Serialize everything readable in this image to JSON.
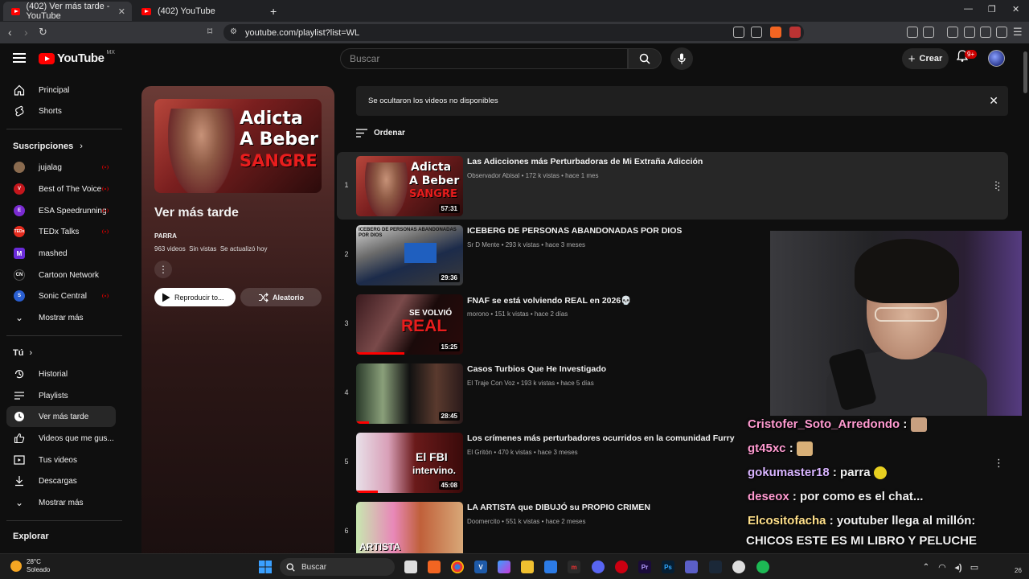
{
  "browser": {
    "tabs": [
      {
        "title": "(402) Ver más tarde - YouTube",
        "active": true
      },
      {
        "title": "(402) YouTube",
        "active": false
      }
    ],
    "new_tab": "+",
    "url": "youtube.com/playlist?list=WL"
  },
  "masthead": {
    "logo": "YouTube",
    "country": "MX",
    "search_placeholder": "Buscar",
    "create_label": "Crear",
    "notif_badge": "9+"
  },
  "sidebar": {
    "main": [
      {
        "label": "Principal",
        "icon": "home-icon"
      },
      {
        "label": "Shorts",
        "icon": "shorts-icon"
      }
    ],
    "subs_title": "Suscripciones",
    "subs": [
      {
        "label": "jujalag",
        "color": "#8a6b4f",
        "abbr": ""
      },
      {
        "label": "Best of The Voice",
        "color": "#c4161c",
        "abbr": "V"
      },
      {
        "label": "ESA Speedrunning",
        "color": "#7a2bd1",
        "abbr": "E"
      },
      {
        "label": "TEDx Talks",
        "color": "#e62b1e",
        "abbr": "TEDx"
      },
      {
        "label": "mashed",
        "color": "#6a2bd9",
        "abbr": "M"
      },
      {
        "label": "Cartoon Network",
        "color": "#111111",
        "abbr": "CN"
      },
      {
        "label": "Sonic Central",
        "color": "#2a5fd1",
        "abbr": "S"
      }
    ],
    "subs_more": "Mostrar más",
    "you_title": "Tú",
    "you": [
      {
        "label": "Historial",
        "icon": "history-icon"
      },
      {
        "label": "Playlists",
        "icon": "playlists-icon"
      },
      {
        "label": "Ver más tarde",
        "icon": "watch-later-icon"
      },
      {
        "label": "Videos que me gus...",
        "icon": "thumbs-up-icon"
      },
      {
        "label": "Tus videos",
        "icon": "your-videos-icon"
      },
      {
        "label": "Descargas",
        "icon": "download-icon"
      }
    ],
    "you_more": "Mostrar más",
    "explore_title": "Explorar"
  },
  "playlist": {
    "thumb_line1": "Adicta",
    "thumb_line2": "A Beber",
    "thumb_line3": "SANGRE",
    "title": "Ver más tarde",
    "owner": "PARRA",
    "videos": "963 videos",
    "views": "Sin vistas",
    "updated": "Se actualizó hoy",
    "play_all": "Reproducir to...",
    "shuffle": "Aleatorio"
  },
  "notice": "Se ocultaron los videos no disponibles",
  "sort_label": "Ordenar",
  "videos": [
    {
      "index": "1",
      "title": "Las Adicciones más Perturbadoras de Mi Extraña Adicción",
      "channel": "Observador Abisal",
      "views": "172 k vistas",
      "age": "hace 1 mes",
      "duration": "57:31",
      "progress": 0
    },
    {
      "index": "2",
      "title": "ICEBERG DE PERSONAS ABANDONADAS POR DIOS",
      "channel": "Sr D Mente",
      "views": "293 k vistas",
      "age": "hace 3 meses",
      "duration": "29:36",
      "progress": 0
    },
    {
      "index": "3",
      "title": "FNAF se está volviendo REAL en 2026💀",
      "channel": "morono",
      "views": "151 k vistas",
      "age": "hace 2 días",
      "duration": "15:25",
      "progress": 0.45
    },
    {
      "index": "4",
      "title": "Casos Turbios Que He Investigado",
      "channel": "El Traje Con Voz",
      "views": "193 k vistas",
      "age": "hace 5 días",
      "duration": "28:45",
      "progress": 0.12
    },
    {
      "index": "5",
      "title": "Los crímenes más perturbadores ocurridos en la comunidad Furry",
      "channel": "El Gritón",
      "views": "470 k vistas",
      "age": "hace 3 meses",
      "duration": "45:08",
      "progress": 0.2
    },
    {
      "index": "6",
      "title": "LA ARTISTA que DIBUJÓ su PROPIO CRIMEN",
      "channel": "Doomercito",
      "views": "551 k vistas",
      "age": "hace 2 meses",
      "duration": "",
      "progress": 0
    }
  ],
  "thumb_text": {
    "t2": "ICEBERG DE PERSONAS ABANDONADAS POR DIOS",
    "t3a": "SE VOLVIÓ",
    "t3b": "REAL",
    "t5a": "El FBI",
    "t5b": "intervino.",
    "t6": "ARTISTA"
  },
  "chat": [
    {
      "user": "Cristofer_Soto_Arredondo",
      "sep": " :",
      "msg": ""
    },
    {
      "user": "gt45xc",
      "sep": " :",
      "msg": ""
    },
    {
      "user": "gokumaster18",
      "sep": " :",
      "msg": " parra"
    },
    {
      "user": "deseox",
      "sep": " :",
      "msg": " por como es el chat..."
    },
    {
      "user": "Elcositofacha",
      "sep": " :",
      "msg": " youtuber llega al millón:"
    },
    {
      "user": "",
      "sep": "",
      "msg": "CHICOS ESTE ES MI LIBRO Y PELUCHE"
    }
  ],
  "taskbar": {
    "temp": "28°C",
    "weather": "Soleado",
    "search": "Buscar",
    "time": "26"
  }
}
